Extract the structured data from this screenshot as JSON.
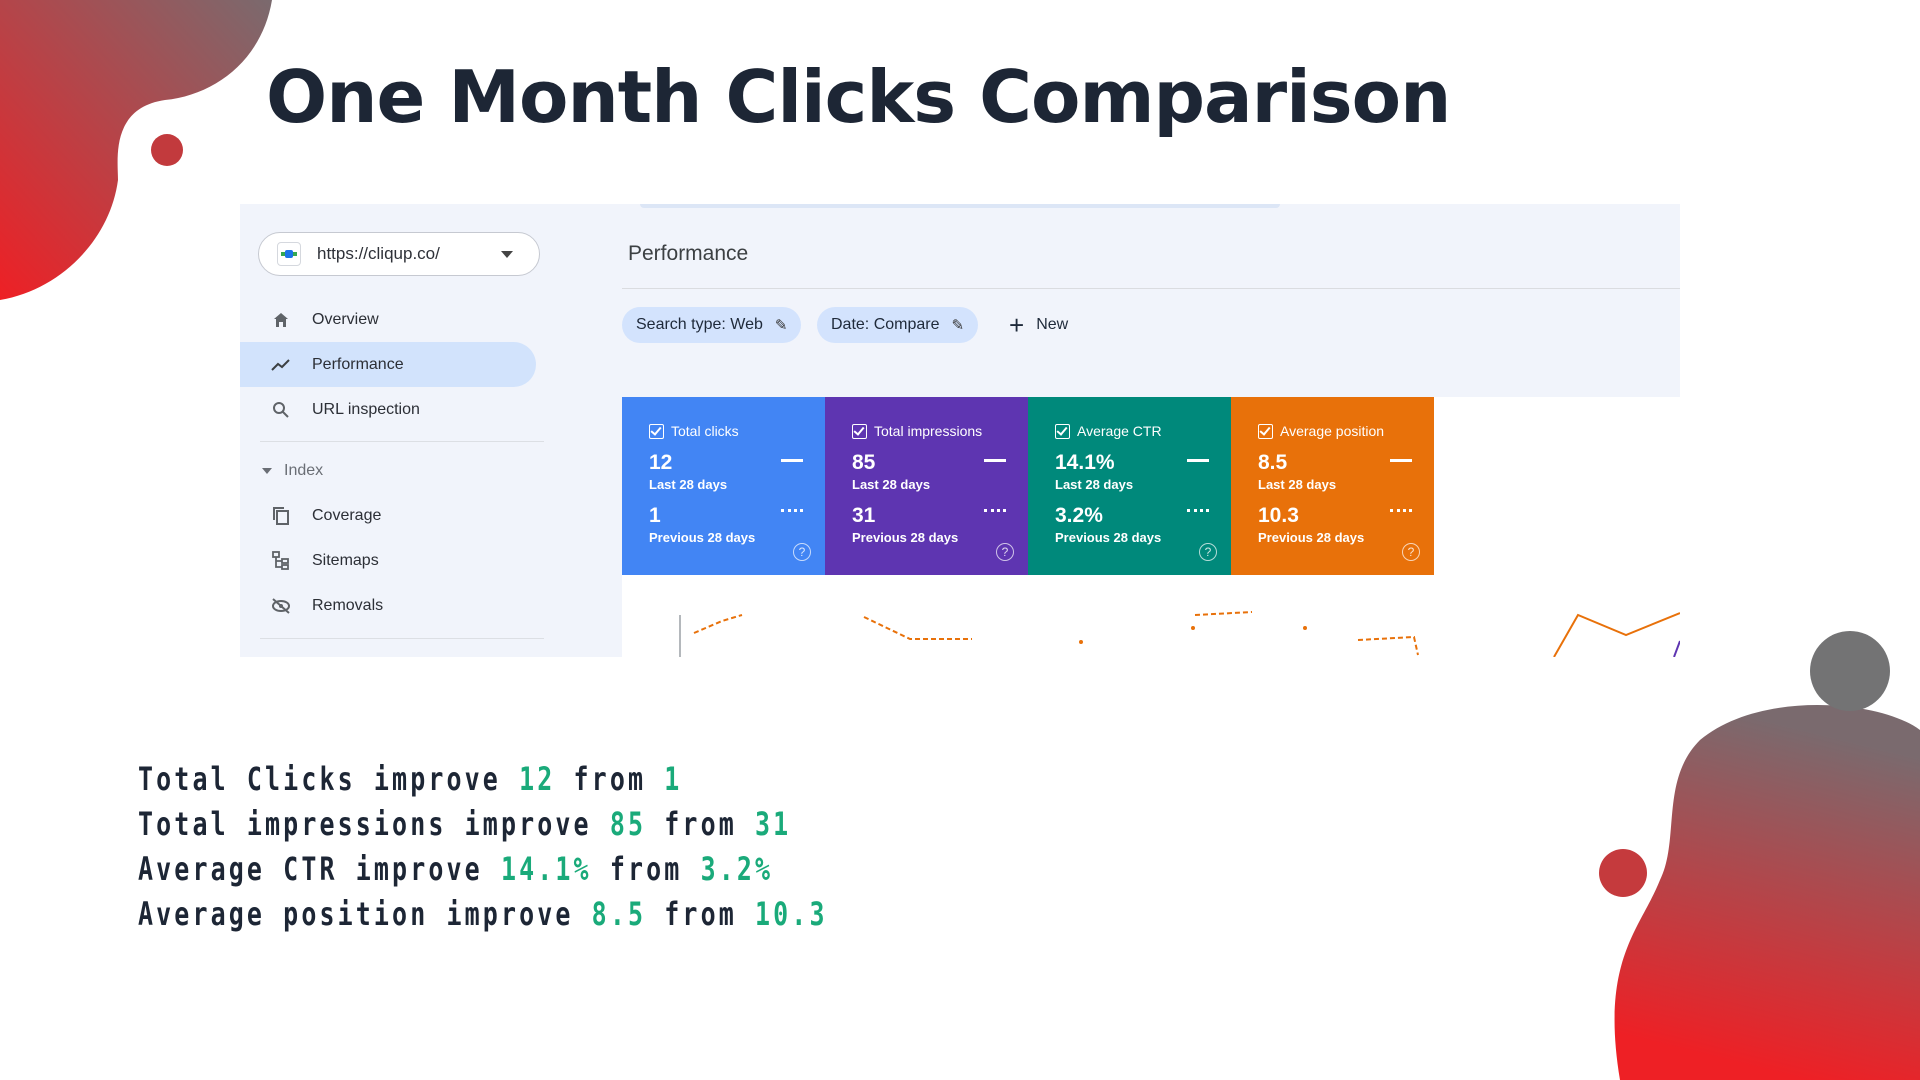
{
  "slide": {
    "title": "One Month Clicks Comparison"
  },
  "console": {
    "property_url": "https://cliqup.co/",
    "nav": {
      "overview": "Overview",
      "performance": "Performance",
      "url_inspection": "URL inspection",
      "index_section": "Index",
      "coverage": "Coverage",
      "sitemaps": "Sitemaps",
      "removals": "Removals"
    },
    "page_title": "Performance",
    "filters": {
      "search_type": "Search type: Web",
      "date": "Date: Compare",
      "new_label": "New"
    },
    "metrics": [
      {
        "label": "Total clicks",
        "current": "12",
        "current_period": "Last 28 days",
        "previous": "1",
        "previous_period": "Previous 28 days",
        "color": "#4285f4"
      },
      {
        "label": "Total impressions",
        "current": "85",
        "current_period": "Last 28 days",
        "previous": "31",
        "previous_period": "Previous 28 days",
        "color": "#5e35b1"
      },
      {
        "label": "Average CTR",
        "current": "14.1%",
        "current_period": "Last 28 days",
        "previous": "3.2%",
        "previous_period": "Previous 28 days",
        "color": "#00897b"
      },
      {
        "label": "Average position",
        "current": "8.5",
        "current_period": "Last 28 days",
        "previous": "10.3",
        "previous_period": "Previous 28 days",
        "color": "#e8710a"
      }
    ]
  },
  "summary": {
    "line1": {
      "text": "Total Clicks improve",
      "value": "12",
      "mid": "from",
      "prev": "1"
    },
    "line2": {
      "text": "Total impressions improve",
      "value": "85",
      "mid": "from",
      "prev": "31"
    },
    "line3": {
      "text": "Average CTR improve",
      "value": "14.1%",
      "mid": "from",
      "prev": "3.2%"
    },
    "line4": {
      "text": "Average position improve",
      "value": "8.5",
      "mid": "from",
      "prev": "10.3"
    }
  },
  "colors": {
    "title": "#1d2635",
    "highlight": "#1aaa7a",
    "deco_red": "#e8262b",
    "deco_gray": "#7a6a6e"
  }
}
